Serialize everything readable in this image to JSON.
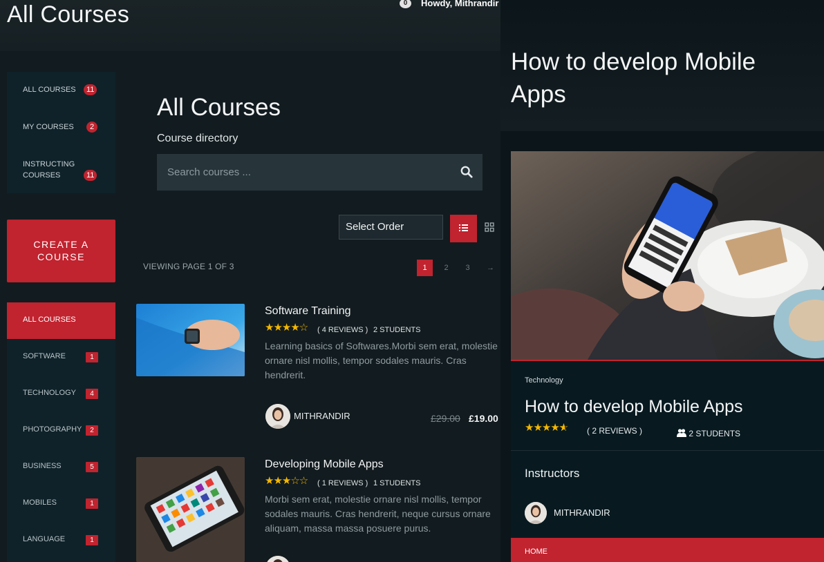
{
  "topbar": {
    "title": "All Courses",
    "notification_count": "0",
    "howdy": "Howdy, Mithrandir"
  },
  "profile_menu": [
    {
      "label": "ALL COURSES",
      "count": "11"
    },
    {
      "label": "MY COURSES",
      "count": "2"
    },
    {
      "label": "INSTRUCTING COURSES",
      "count": "11"
    }
  ],
  "create_course": "CREATE A COURSE",
  "categories": [
    {
      "label": "ALL COURSES"
    },
    {
      "label": "SOFTWARE",
      "count": "1"
    },
    {
      "label": "TECHNOLOGY",
      "count": "4"
    },
    {
      "label": "PHOTOGRAPHY",
      "count": "2"
    },
    {
      "label": "BUSINESS",
      "count": "5"
    },
    {
      "label": "MOBILES",
      "count": "1"
    },
    {
      "label": "LANGUAGE",
      "count": "1"
    }
  ],
  "main": {
    "title": "All Courses",
    "subtitle": "Course directory",
    "search_placeholder": "Search courses ...",
    "select_order": "Select Order",
    "viewing": "VIEWING PAGE 1 OF 3",
    "pages": [
      "1",
      "2",
      "3",
      "→"
    ]
  },
  "courses": [
    {
      "title": "Software Training",
      "rating": 4,
      "reviews": "( 4 REVIEWS )",
      "students": "2 STUDENTS",
      "description": "Learning basics of Softwares.Morbi sem erat, molestie ornare nisl mollis, tempor sodales mauris. Cras hendrerit.",
      "instructor": "MITHRANDIR",
      "price_old": "£29.00",
      "price_new": "£19.00"
    },
    {
      "title": "Developing Mobile Apps",
      "rating": 3,
      "reviews": "( 1 REVIEWS )",
      "students": "1 STUDENTS",
      "description": "Morbi sem erat, molestie ornare nisl mollis, tempor sodales mauris. Cras hendrerit, neque cursus ornare aliquam, massa massa posuere purus."
    }
  ],
  "detail": {
    "header_title": "How to develop Mobile Apps",
    "category": "Technology",
    "title": "How to develop Mobile Apps",
    "rating": 4.5,
    "reviews": "( 2 REVIEWS )",
    "students": "2 STUDENTS",
    "instructors_heading": "Instructors",
    "instructor": "MITHRANDIR",
    "home": "HOME"
  },
  "colors": {
    "accent": "#c1232f",
    "star": "#f5b800",
    "panel": "#0f2229"
  }
}
